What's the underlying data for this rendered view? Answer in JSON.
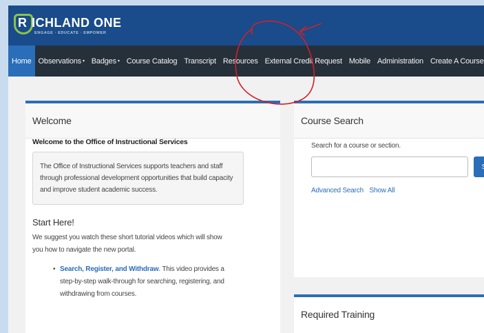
{
  "header": {
    "logo_letter": "R",
    "logo_title": "ICHLAND ONE",
    "logo_tagline": "ENGAGE · EDUCATE · EMPOWER",
    "brand_color": "#1a4b8a",
    "accent_color": "#8bc34a"
  },
  "nav": {
    "items": [
      {
        "label": "Home",
        "active": true
      },
      {
        "label": "Observations",
        "dropdown": true
      },
      {
        "label": "Badges",
        "dropdown": true
      },
      {
        "label": "Course Catalog"
      },
      {
        "label": "Transcript"
      },
      {
        "label": "Resources"
      },
      {
        "label": "External Credit Request"
      },
      {
        "label": "Mobile"
      },
      {
        "label": "Administration"
      },
      {
        "label": "Create A Course"
      }
    ],
    "caret": "▾"
  },
  "welcome": {
    "title": "Welcome",
    "heading": "Welcome to the Office of Instructional Services",
    "well_text": "The Office of Instructional Services supports teachers and staff through professional development opportunities that build capacity and improve student academic success.",
    "start_heading": "Start Here!",
    "start_text": "We suggest you watch these short tutorial videos which will show you how to navigate the new portal.",
    "tutorials": [
      {
        "link": "Search, Register, and Withdraw",
        "text": ". This video provides a step-by-step walk-through for searching, registering, and withdrawing from courses."
      }
    ]
  },
  "course_search": {
    "title": "Course Search",
    "label": "Search for a course or section.",
    "input_value": "",
    "button_label": "S",
    "links": [
      "Advanced Search",
      "Show All"
    ]
  },
  "training": {
    "title": "Required Training"
  },
  "colors": {
    "nav_bg": "#26303b",
    "active_tab": "#2a6db8",
    "annotation": "#d0202a"
  }
}
